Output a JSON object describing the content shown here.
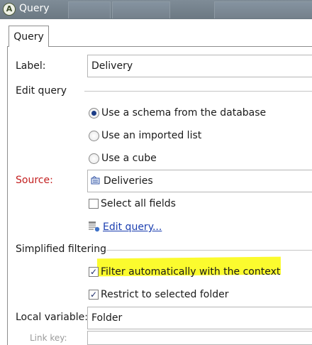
{
  "window": {
    "title": "Query",
    "app_icon": "app-logo-icon"
  },
  "tabs": [
    {
      "label": "Query",
      "selected": true
    }
  ],
  "form": {
    "label_caption": "Label:",
    "label_value": "Delivery",
    "edit_query_group": "Edit query",
    "schema_options": [
      {
        "label": "Use a schema from the database",
        "selected": true
      },
      {
        "label": "Use an imported list",
        "selected": false
      },
      {
        "label": "Use a cube",
        "selected": false
      }
    ],
    "source_caption": "Source:",
    "source_value": "Deliveries",
    "select_all_fields": {
      "label": "Select all fields",
      "checked": false
    },
    "edit_query_link": "Edit query...",
    "simplified_filtering_group": "Simplified filtering",
    "filter_context": {
      "label": "Filter automatically with the context",
      "checked": true
    },
    "restrict_folder": {
      "label": "Restrict to selected folder",
      "checked": true
    },
    "local_variable_caption": "Local variable:",
    "local_variable_value": "Folder",
    "link_key_caption": "Link key:"
  },
  "colors": {
    "highlight": "#fbfb2e",
    "required_label": "#c32020",
    "link": "#1c3fb0"
  }
}
